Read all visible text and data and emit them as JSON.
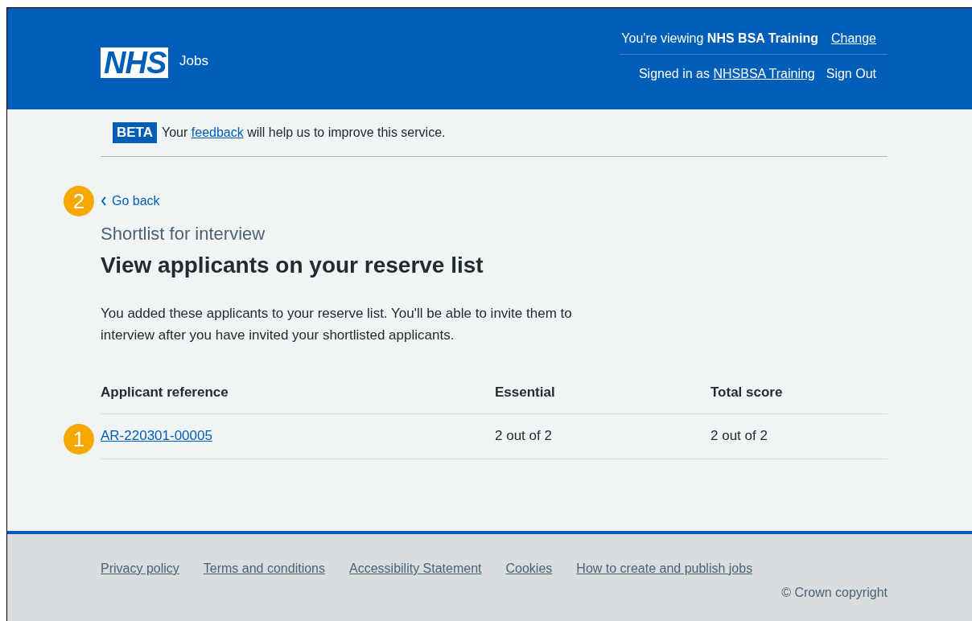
{
  "header": {
    "logo": "NHS",
    "service": "Jobs",
    "viewing_prefix": "You're viewing ",
    "viewing_org": "NHS BSA Training",
    "change_link": "Change",
    "signed_in_prefix": "Signed in as ",
    "signed_in_user": "NHSBSA Training",
    "sign_out": "Sign Out"
  },
  "beta_banner": {
    "tag": "BETA",
    "text_before": "Your ",
    "link": "feedback",
    "text_after": " will help us to improve this service."
  },
  "back_link": {
    "label": "Go back",
    "callout": "2"
  },
  "caption": "Shortlist for interview",
  "title": "View applicants on your reserve list",
  "intro": "You added these applicants to your reserve list. You'll be able to invite them to interview after you have invited your shortlisted applicants.",
  "table": {
    "columns": [
      "Applicant reference",
      "Essential",
      "Total score"
    ],
    "rows": [
      {
        "reference": "AR-220301-00005",
        "essential": "2 out of 2",
        "total": "2 out of 2",
        "callout": "1"
      }
    ]
  },
  "footer": {
    "links": [
      "Privacy policy",
      "Terms and conditions",
      "Accessibility Statement",
      "Cookies",
      "How to create and publish jobs"
    ],
    "copyright": "© Crown copyright"
  }
}
